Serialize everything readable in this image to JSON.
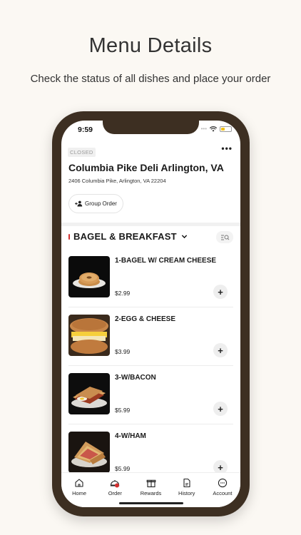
{
  "promo": {
    "title": "Menu Details",
    "subtitle": "Check the status of all dishes and place your order"
  },
  "status_bar": {
    "time": "9:59"
  },
  "store": {
    "status_badge": "CLOSED",
    "name": "Columbia Pike Deli Arlington, VA",
    "address": "2406 Columbia Pike, Arlington, VA 22204",
    "group_order_label": "Group Order"
  },
  "category": {
    "title": "BAGEL & BREAKFAST"
  },
  "menu_items": [
    {
      "name": "1-BAGEL W/ CREAM CHEESE",
      "price": "$2.99"
    },
    {
      "name": "2-EGG & CHEESE",
      "price": "$3.99"
    },
    {
      "name": "3-W/BACON",
      "price": "$5.99"
    },
    {
      "name": "4-W/HAM",
      "price": "$5.99"
    }
  ],
  "add_label": "+",
  "tabs": [
    {
      "label": "Home",
      "icon": "home-icon"
    },
    {
      "label": "Order",
      "icon": "order-icon"
    },
    {
      "label": "Rewards",
      "icon": "rewards-icon"
    },
    {
      "label": "History",
      "icon": "history-icon"
    },
    {
      "label": "Account",
      "icon": "account-icon"
    }
  ],
  "colors": {
    "phone_frame": "#3d2f22",
    "background": "#fbf8f3",
    "accent": "#d32f2f"
  }
}
